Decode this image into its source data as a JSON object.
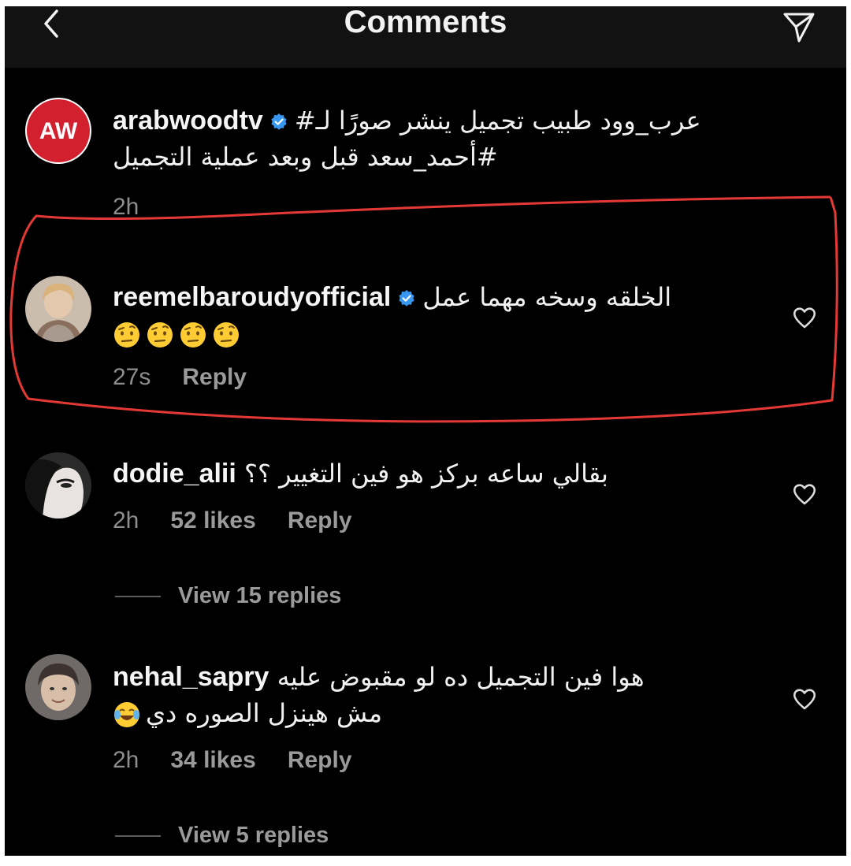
{
  "header": {
    "title": "Comments"
  },
  "comments": [
    {
      "username": "arabwoodtv",
      "verified": true,
      "avatar_text": "AW",
      "line1": "عرب_وود  طبيب تجميل ينشر صورًا لـ#",
      "line2": "#أحمد_سعد قبل وبعد عملية التجميل",
      "time": "2h"
    },
    {
      "username": "reemelbaroudyofficial",
      "verified": true,
      "line1": "الخلقه وسخه مهما عمل",
      "emoji_count": 4,
      "time": "27s",
      "reply_label": "Reply"
    },
    {
      "username": "dodie_alii",
      "verified": false,
      "line1": "بقالي ساعه بركز هو فين التغيير ؟؟",
      "time": "2h",
      "likes": "52 likes",
      "reply_label": "Reply",
      "view_replies": "View 15 replies"
    },
    {
      "username": "nehal_sapry",
      "verified": false,
      "line1": "هوا فين التجميل ده لو مقبوض عليه",
      "line2": "مش هينزل الصوره دي",
      "time": "2h",
      "likes": "34 likes",
      "reply_label": "Reply",
      "view_replies": "View 5 replies"
    }
  ],
  "colors": {
    "background": "#000000",
    "header_bg": "#121212",
    "text": "#f1f1f1",
    "muted": "#8e8e8e",
    "verified": "#3897f0",
    "brand_red": "#d3202f",
    "highlight": "#e53935"
  },
  "icons": {
    "back": "chevron-left-icon",
    "share": "send-icon",
    "like": "heart-icon",
    "verified": "verified-badge-icon",
    "emoji": "face-with-raised-eyebrow-emoji"
  }
}
